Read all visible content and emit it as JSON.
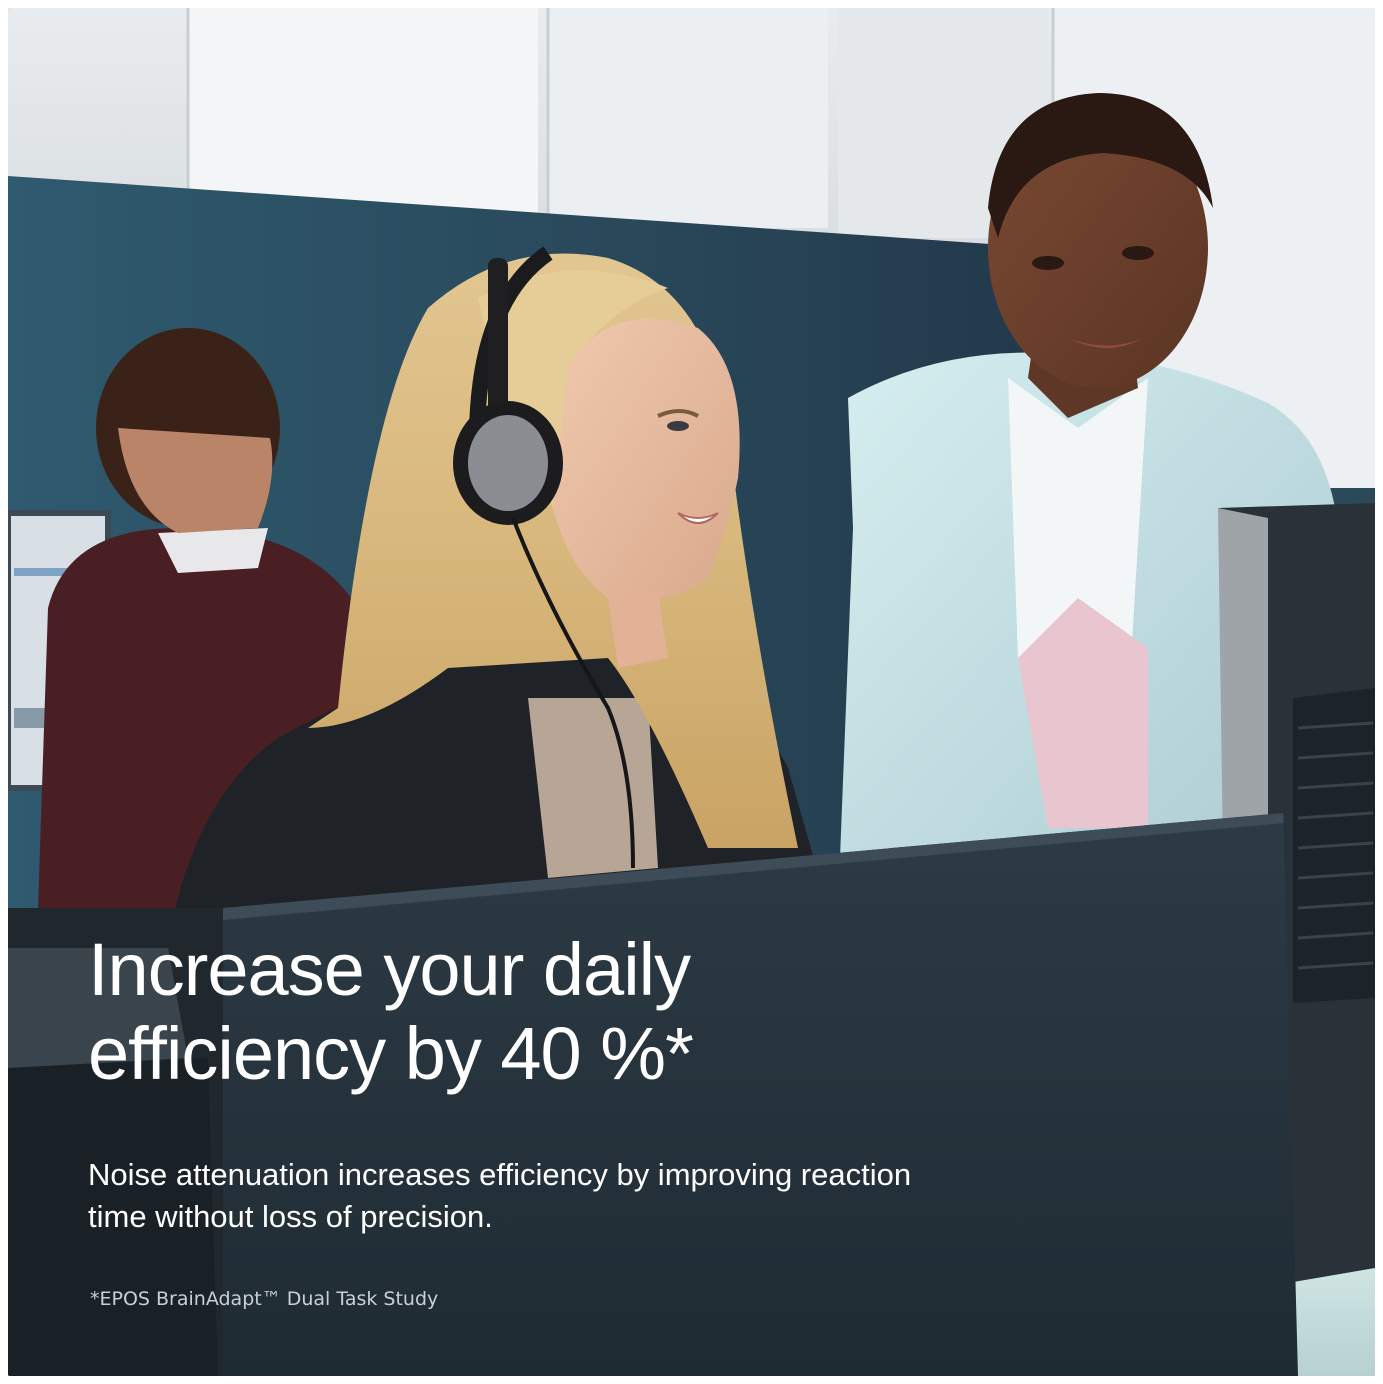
{
  "headline": {
    "line1": "Increase your daily",
    "line2": "efficiency by 40 %*"
  },
  "body_text": "Noise attenuation increases efficiency by improving reaction time without loss of precision.",
  "footnote": "*EPOS BrainAdapt™ Dual Task Study",
  "colors": {
    "text": "#ffffff",
    "footnote_text": "#c9d0d4",
    "monitor_back": "#27353f",
    "wall_blue": "#2f5366"
  }
}
